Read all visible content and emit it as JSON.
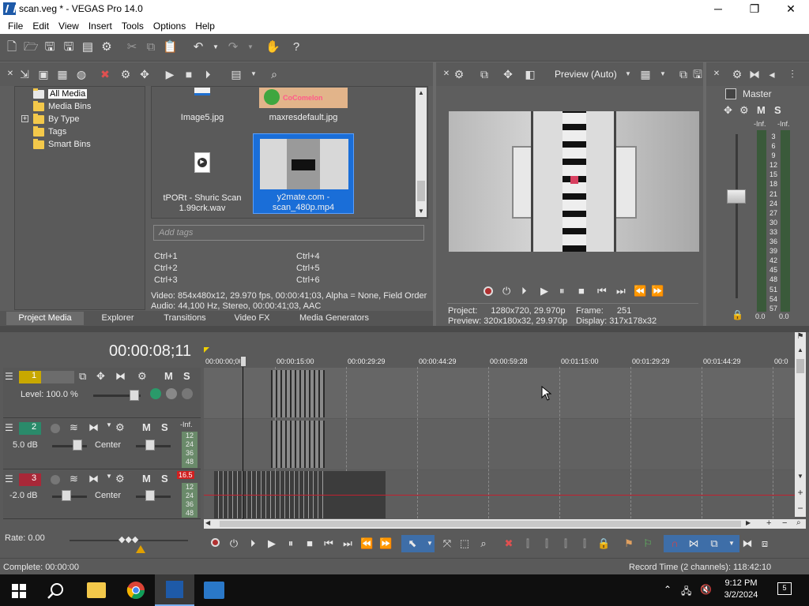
{
  "window": {
    "title": "scan.veg * - VEGAS Pro 14.0",
    "minimize": "─",
    "maximize": "❐",
    "close": "✕"
  },
  "menu": [
    "File",
    "Edit",
    "View",
    "Insert",
    "Tools",
    "Options",
    "Help"
  ],
  "project_media": {
    "tree": [
      {
        "label": "All Media",
        "selected": true
      },
      {
        "label": "Media Bins"
      },
      {
        "label": "By Type",
        "expandable": true,
        "expand_glyph": "+"
      },
      {
        "label": "Tags"
      },
      {
        "label": "Smart Bins"
      }
    ],
    "items": [
      {
        "label": "Image5.jpg"
      },
      {
        "label": "maxresdefault.jpg",
        "thumb_text": "CoComelon"
      },
      {
        "label_lines": [
          "tPORt - Shuric Scan",
          "1.99crk.wav"
        ]
      },
      {
        "label_lines": [
          "y2mate.com -",
          "scan_480p.mp4"
        ],
        "selected": true
      }
    ],
    "tags_placeholder": "Add tags",
    "shortcuts": [
      "Ctrl+1",
      "Ctrl+2",
      "Ctrl+3",
      "Ctrl+4",
      "Ctrl+5",
      "Ctrl+6"
    ],
    "info_video": "Video: 854x480x12, 29.970 fps, 00:00:41;03, Alpha = None, Field Order",
    "info_audio": "Audio: 44,100 Hz, Stereo, 00:00:41;03, AAC"
  },
  "tabs": [
    "Project Media",
    "Explorer",
    "Transitions",
    "Video FX",
    "Media Generators"
  ],
  "preview": {
    "quality": "Preview (Auto)",
    "project_label": "Project:",
    "project_value": "1280x720, 29.970p",
    "preview_label": "Preview:",
    "preview_value": "320x180x32, 29.970p",
    "frame_label": "Frame:",
    "frame_value": "251",
    "display_label": "Display:",
    "display_value": "317x178x32"
  },
  "master": {
    "label": "Master",
    "mute": "M",
    "solo": "S",
    "peak_left": "-Inf.",
    "peak_right": "-Inf.",
    "scale": [
      "3",
      "6",
      "9",
      "12",
      "15",
      "18",
      "21",
      "24",
      "27",
      "30",
      "33",
      "36",
      "39",
      "42",
      "45",
      "48",
      "51",
      "54",
      "57"
    ],
    "readout_left": "0.0",
    "readout_right": "0.0"
  },
  "timeline": {
    "timecode": "00:00:08;11",
    "ruler": [
      "00:00:00;00",
      "00:00:15:00",
      "00:00:29:29",
      "00:00:44:29",
      "00:00:59:28",
      "00:01:15:00",
      "00:01:29:29",
      "00:01:44:29",
      "00:0"
    ],
    "tracks": [
      {
        "number": "1",
        "type": "video",
        "level_label": "Level: 100.0 %",
        "mute": "M",
        "solo": "S"
      },
      {
        "number": "2",
        "type": "audio",
        "volume": "5.0 dB",
        "pan": "Center",
        "mute": "M",
        "solo": "S",
        "meter_top": "-Inf.",
        "meter": [
          "12",
          "24",
          "36",
          "48"
        ]
      },
      {
        "number": "3",
        "type": "audio",
        "volume": "-2.0 dB",
        "pan": "Center",
        "mute": "M",
        "solo": "S",
        "meter_top": "16.5",
        "meter": [
          "12",
          "24",
          "36",
          "48"
        ]
      }
    ],
    "rate": "Rate: 0.00"
  },
  "status": {
    "complete": "Complete: 00:00:00",
    "record_time": "Record Time (2 channels): 118:42:10"
  },
  "taskbar": {
    "time": "9:12 PM",
    "date": "3/2/2024",
    "notifications": "5"
  },
  "colors": {
    "track1": "#c8a800",
    "track2": "#2a8a6a",
    "track3": "#a82838",
    "selection": "#1a6ed8",
    "playline": "#c02030"
  }
}
